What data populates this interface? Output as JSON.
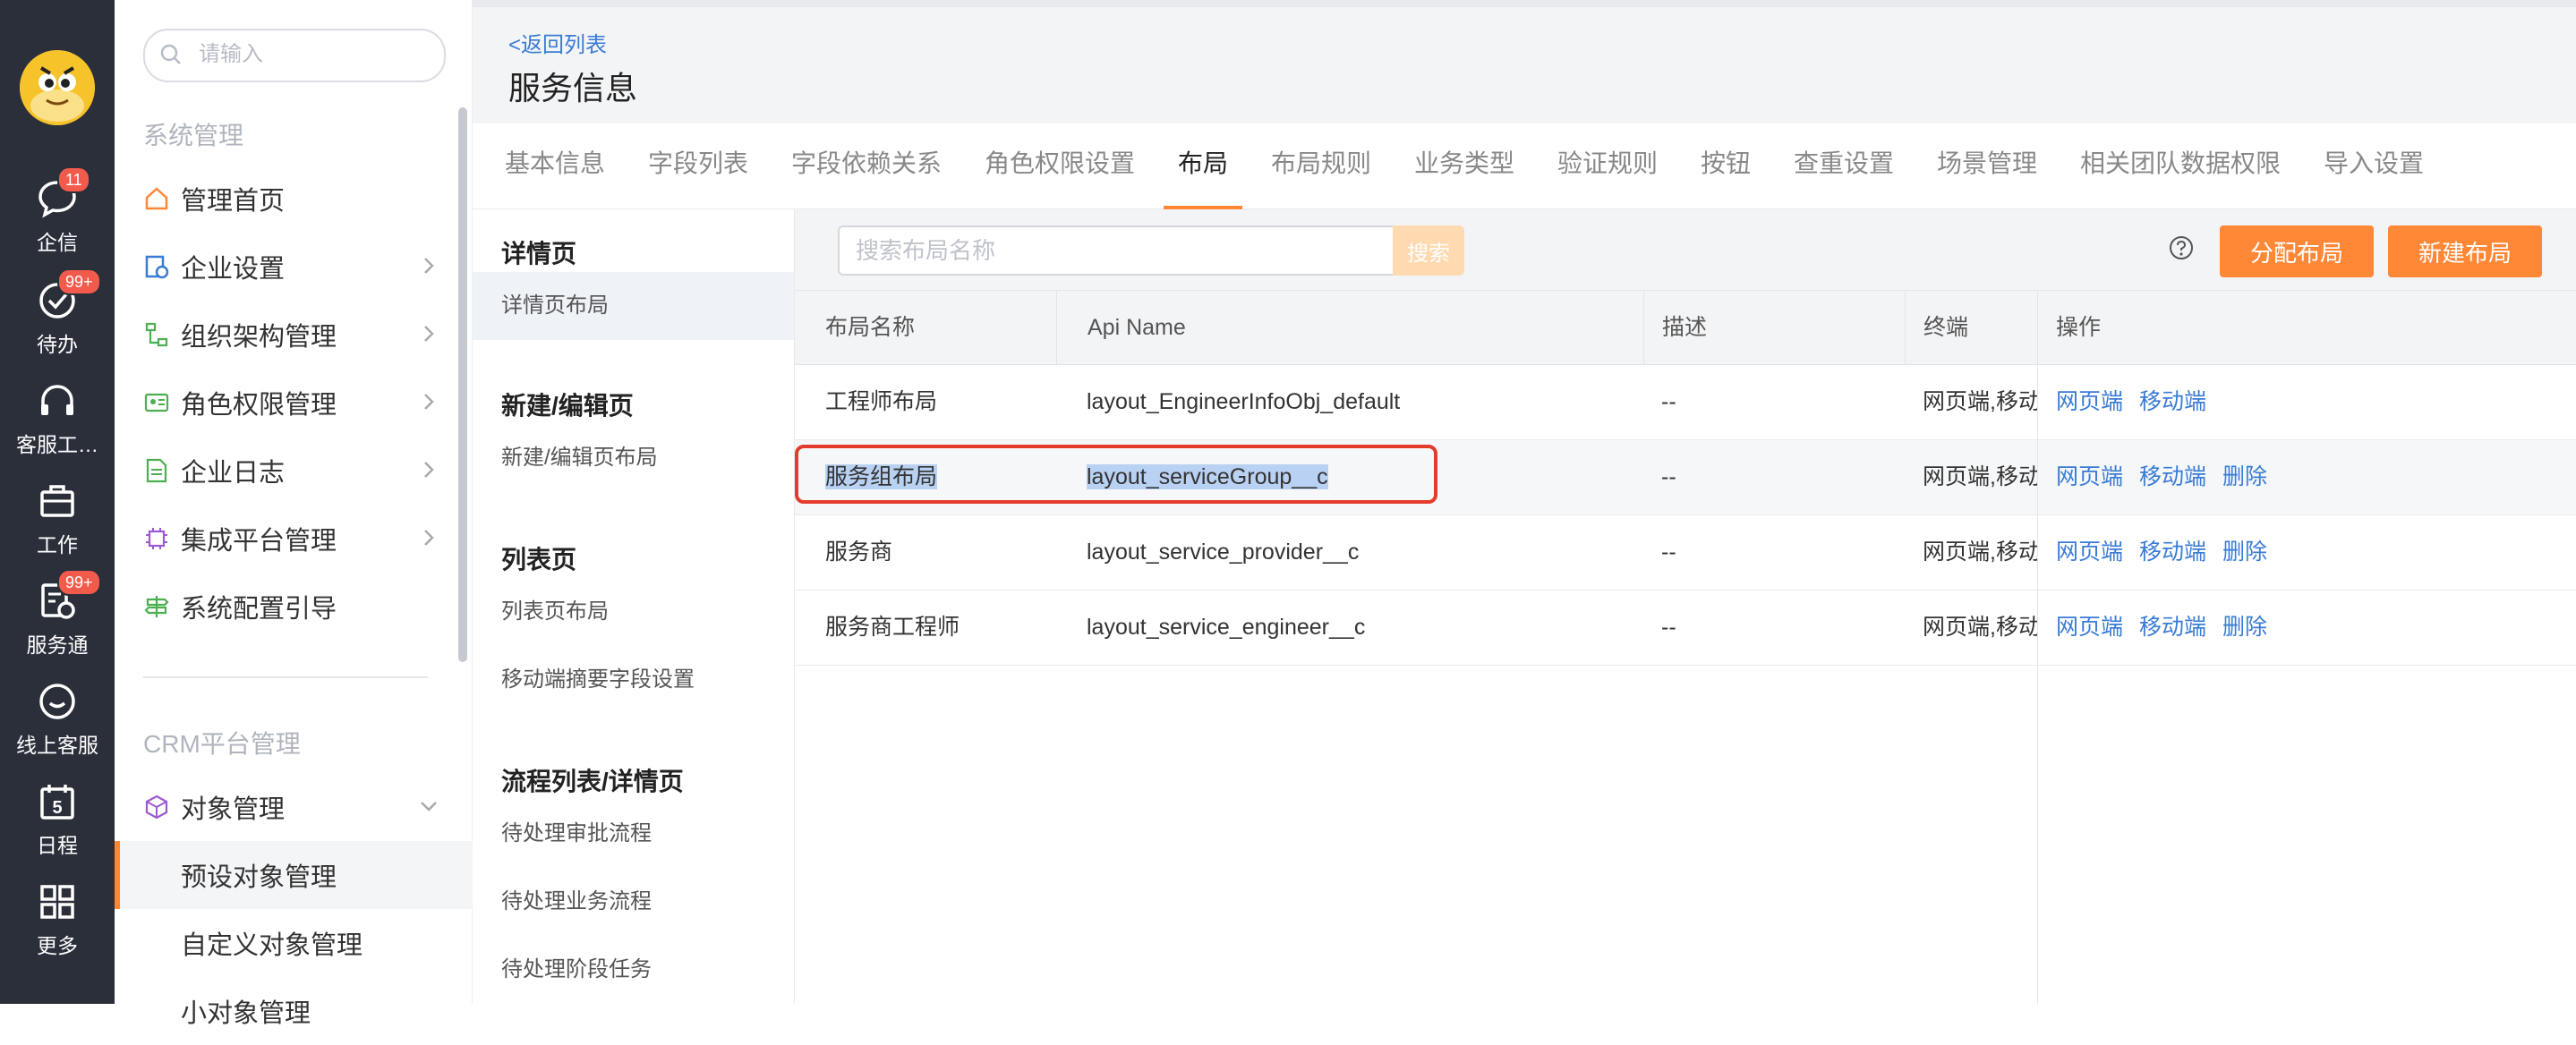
{
  "rail": {
    "items": [
      {
        "label": "企信",
        "icon": "chat-bubble-icon",
        "badge": "11"
      },
      {
        "label": "待办",
        "icon": "check-circle-icon",
        "badge": "99+"
      },
      {
        "label": "客服工…",
        "icon": "headset-icon",
        "badge": ""
      },
      {
        "label": "工作",
        "icon": "briefcase-icon",
        "badge": ""
      },
      {
        "label": "服务通",
        "icon": "service-tool-icon",
        "badge": "99+"
      },
      {
        "label": "线上客服",
        "icon": "smile-chat-icon",
        "badge": ""
      },
      {
        "label": "日程",
        "icon": "calendar-icon",
        "badge": "",
        "day": "5"
      },
      {
        "label": "更多",
        "icon": "grid-icon",
        "badge": ""
      }
    ]
  },
  "sidebar": {
    "search_placeholder": "请输入",
    "group1": "系统管理",
    "items": [
      {
        "label": "管理首页",
        "icon": "home-icon"
      },
      {
        "label": "企业设置",
        "icon": "enterprise-settings-icon"
      },
      {
        "label": "组织架构管理",
        "icon": "org-structure-icon"
      },
      {
        "label": "角色权限管理",
        "icon": "role-card-icon"
      },
      {
        "label": "企业日志",
        "icon": "log-document-icon"
      },
      {
        "label": "集成平台管理",
        "icon": "chip-icon"
      },
      {
        "label": "系统配置引导",
        "icon": "signpost-icon"
      }
    ],
    "group2": "CRM平台管理",
    "object_mgmt": "对象管理",
    "sub_items": [
      "预设对象管理",
      "自定义对象管理",
      "小对象管理"
    ]
  },
  "header": {
    "back": "<返回列表",
    "title": "服务信息"
  },
  "tabs": [
    "基本信息",
    "字段列表",
    "字段依赖关系",
    "角色权限设置",
    "布局",
    "布局规则",
    "业务类型",
    "验证规则",
    "按钮",
    "查重设置",
    "场景管理",
    "相关团队数据权限",
    "导入设置"
  ],
  "active_tab": "布局",
  "layout_nav": {
    "detail_head": "详情页",
    "detail_item": "详情页布局",
    "edit_head": "新建/编辑页",
    "edit_item": "新建/编辑页布局",
    "list_head": "列表页",
    "list_item": "列表页布局",
    "mobile_item": "移动端摘要字段设置",
    "flow_head": "流程列表/详情页",
    "flow_items": [
      "待处理审批流程",
      "待处理业务流程",
      "待处理阶段任务"
    ]
  },
  "toolbar": {
    "search_placeholder": "搜索布局名称",
    "search_btn": "搜索",
    "assign_btn": "分配布局",
    "new_btn": "新建布局"
  },
  "table": {
    "columns": [
      "布局名称",
      "Api Name",
      "描述",
      "终端",
      "操作"
    ],
    "rows": [
      {
        "name": "工程师布局",
        "api": "layout_EngineerInfoObj_default",
        "desc": "--",
        "terminal": "网页端,移动端",
        "ops": [
          "网页端",
          "移动端"
        ]
      },
      {
        "name": "服务组布局",
        "api": "layout_serviceGroup__c",
        "desc": "--",
        "terminal": "网页端,移动端",
        "ops": [
          "网页端",
          "移动端",
          "删除"
        ]
      },
      {
        "name": "服务商",
        "api": "layout_service_provider__c",
        "desc": "--",
        "terminal": "网页端,移动端",
        "ops": [
          "网页端",
          "移动端",
          "删除"
        ]
      },
      {
        "name": "服务商工程师",
        "api": "layout_service_engineer__c",
        "desc": "--",
        "terminal": "网页端,移动端",
        "ops": [
          "网页端",
          "移动端",
          "删除"
        ]
      }
    ]
  },
  "colors": {
    "accent": "#ff8837",
    "link": "#3a7bd5",
    "rail_bg": "#2b2f3a",
    "badge": "#f25b4b",
    "highlight_border": "#e53b2c"
  }
}
